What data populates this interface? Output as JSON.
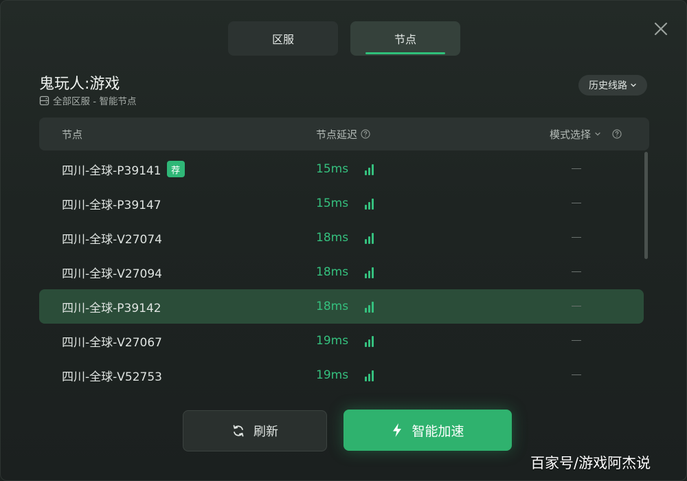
{
  "tabs": [
    {
      "label": "区服",
      "active": false
    },
    {
      "label": "节点",
      "active": true
    }
  ],
  "game": {
    "title": "鬼玩人:游戏",
    "subtitle": "全部区服 - 智能节点"
  },
  "history_button": {
    "label": "历史线路"
  },
  "table": {
    "columns": {
      "node": "节点",
      "latency": "节点延迟",
      "mode": "模式选择"
    },
    "rows": [
      {
        "name": "四川-全球-P39141",
        "badge": "荐",
        "latency": "15ms",
        "mode": "—",
        "selected": false
      },
      {
        "name": "四川-全球-P39147",
        "badge": "",
        "latency": "15ms",
        "mode": "—",
        "selected": false
      },
      {
        "name": "四川-全球-V27074",
        "badge": "",
        "latency": "18ms",
        "mode": "—",
        "selected": false
      },
      {
        "name": "四川-全球-V27094",
        "badge": "",
        "latency": "18ms",
        "mode": "—",
        "selected": false
      },
      {
        "name": "四川-全球-P39142",
        "badge": "",
        "latency": "18ms",
        "mode": "—",
        "selected": true
      },
      {
        "name": "四川-全球-V27067",
        "badge": "",
        "latency": "19ms",
        "mode": "—",
        "selected": false
      },
      {
        "name": "四川-全球-V52753",
        "badge": "",
        "latency": "19ms",
        "mode": "—",
        "selected": false
      }
    ]
  },
  "buttons": {
    "refresh": "刷新",
    "boost": "智能加速"
  },
  "watermark": "百家号/游戏阿杰说",
  "colors": {
    "accent": "#2fb26e",
    "latency": "#35c07e",
    "selected_row": "#2b4d39"
  },
  "icons": {
    "close": "close-icon",
    "server": "server-icon",
    "chevron": "chevron-down-icon",
    "help": "help-circle-icon",
    "signal": "signal-bars-icon",
    "refresh": "refresh-icon",
    "bolt": "lightning-icon"
  }
}
